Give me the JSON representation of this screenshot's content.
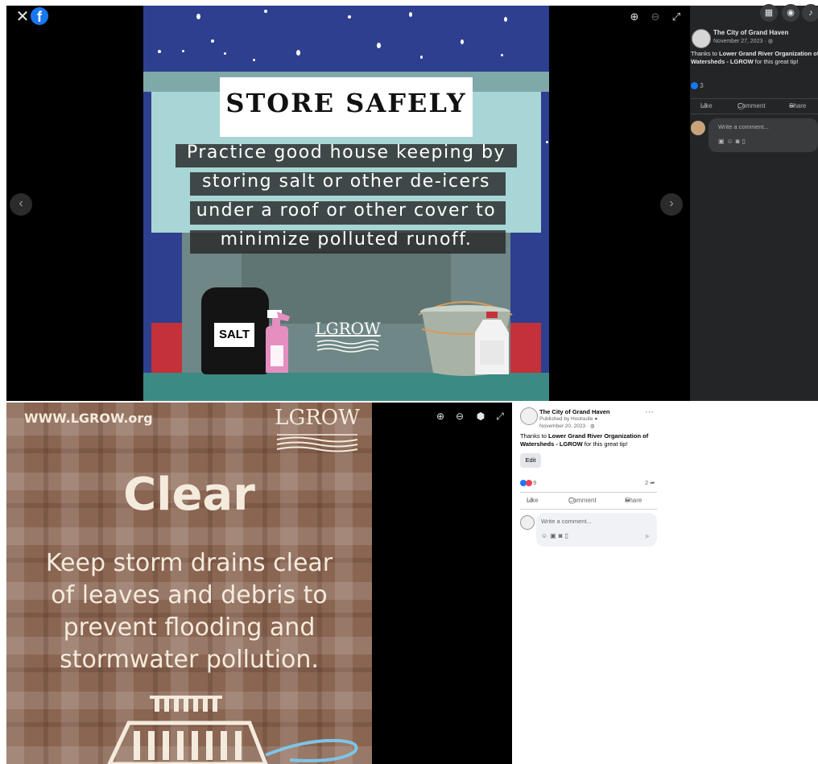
{
  "top_viewer": {
    "close_glyph": "✕",
    "fb_logo": "f",
    "prev_glyph": "‹",
    "next_glyph": "›",
    "zoom_in_glyph": "⊕",
    "zoom_out_glyph": "⊖",
    "fullscreen_glyph": "⤢",
    "store_image": {
      "title": "STORE SAFELY",
      "lines": [
        "Practice good house keeping by",
        "storing salt or other de-icers",
        "under a roof or other cover to",
        "minimize polluted runoff."
      ],
      "salt_label": "SALT",
      "logo_text": "LGROW"
    }
  },
  "dark_panel": {
    "author": "The City of Grand Haven",
    "date": "November 27, 2023 · ",
    "text_prefix": "Thanks to ",
    "text_link": "Lower Grand River Organization of Watersheds - LGROW",
    "text_suffix": " for this great tip!",
    "reaction_count": "3",
    "actions": {
      "like": "Like",
      "comment": "Comment",
      "share": "Share"
    },
    "comment_placeholder": "Write a comment...",
    "top_icons": [
      "menu-grid-icon",
      "messenger-icon",
      "bell-icon"
    ]
  },
  "clear_image": {
    "url": "WWW.LGROW.org",
    "logo_text": "LGROW",
    "title": "Clear",
    "lines": [
      "Keep storm drains clear",
      "of leaves and debris to",
      "prevent  flooding and",
      "stormwater pollution."
    ]
  },
  "bottom_viewer": {
    "zoom_in_glyph": "⊕",
    "zoom_out_glyph": "⊖",
    "tag_glyph": "⬢",
    "fullscreen_glyph": "⤢"
  },
  "light_panel": {
    "author": "The City of Grand Haven",
    "published": "Published by Hootsuite",
    "date": "November 20, 2023 · ",
    "text_prefix": "Thanks to ",
    "text_link": "Lower Grand River Organization of Watersheds - LGROW",
    "text_suffix": " for this great tip!",
    "edit_label": "Edit",
    "reaction_count": "9",
    "share_count": "2",
    "actions": {
      "like": "Like",
      "comment": "Comment",
      "share": "Share"
    },
    "comment_placeholder": "Write a comment...",
    "more_glyph": "···",
    "send_glyph": "➤"
  },
  "colors": {
    "facebook_blue": "#1877f2",
    "dark_panel_bg": "#242526",
    "night_sky": "#2e3f8f",
    "plaid_brown": "#8a6552",
    "love_red": "#f33e58"
  }
}
